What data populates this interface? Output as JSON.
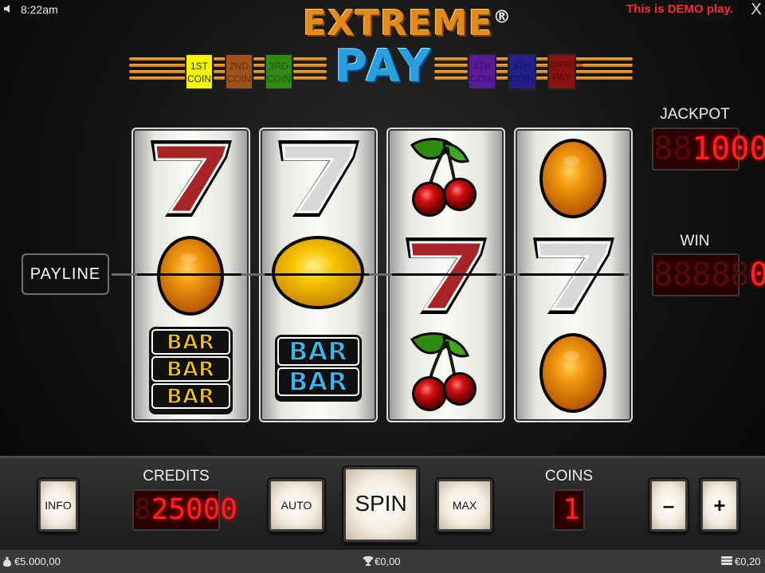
{
  "status_bar": {
    "time": "8:22am",
    "demo_text": "This is DEMO play.",
    "close_label": "X"
  },
  "logo": {
    "line1": "EXTREME",
    "registered": "®",
    "line2": "PAY"
  },
  "coin_indicators": [
    {
      "line1": "1ST",
      "line2": "COIN",
      "color": "#f5f500",
      "text_color": "#3a3a00"
    },
    {
      "line1": "2ND",
      "line2": "COIN",
      "color": "#a0521c",
      "text_color": "#6a3000"
    },
    {
      "line1": "3RD",
      "line2": "COIN",
      "color": "#2f8a14",
      "text_color": "#1a5a06"
    },
    {
      "line1": "4TH",
      "line2": "COIN",
      "color": "#5a1b9a",
      "text_color": "#3a0d6a"
    },
    {
      "line1": "5TH",
      "line2": "COIN",
      "color": "#24208a",
      "text_color": "#14105a"
    },
    {
      "line1": "EXTREME",
      "line2": "PAY",
      "color": "#8a1212",
      "text_color": "#5a0808"
    }
  ],
  "reels": [
    [
      "seven-red",
      "orange",
      "bar-triple"
    ],
    [
      "seven-white",
      "lemon",
      "bar-double"
    ],
    [
      "cherry",
      "seven-red",
      "cherry"
    ],
    [
      "orange",
      "seven-white",
      "orange"
    ]
  ],
  "bar_text": "BAR",
  "payline_label": "PAYLINE",
  "jackpot": {
    "label": "JACKPOT",
    "value": "1000",
    "ghost": "88"
  },
  "win": {
    "label": "WIN",
    "value": "0",
    "ghost": "88888"
  },
  "credits": {
    "label": "CREDITS",
    "value": "25000",
    "ghost": "8"
  },
  "coins": {
    "label": "COINS",
    "value": "1",
    "ghost": "8"
  },
  "buttons": {
    "info": "INFO",
    "auto": "AUTO",
    "spin": "SPIN",
    "max": "MAX",
    "minus": "–",
    "plus": "+"
  },
  "footer": {
    "balance": "€5.000,00",
    "win": "€0,00",
    "bet": "€0,20"
  },
  "colors": {
    "demo": "#ff2a2a",
    "led": "#ff2020",
    "logo_orange": "#e28a1d",
    "logo_blue": "#2a9fe0"
  }
}
